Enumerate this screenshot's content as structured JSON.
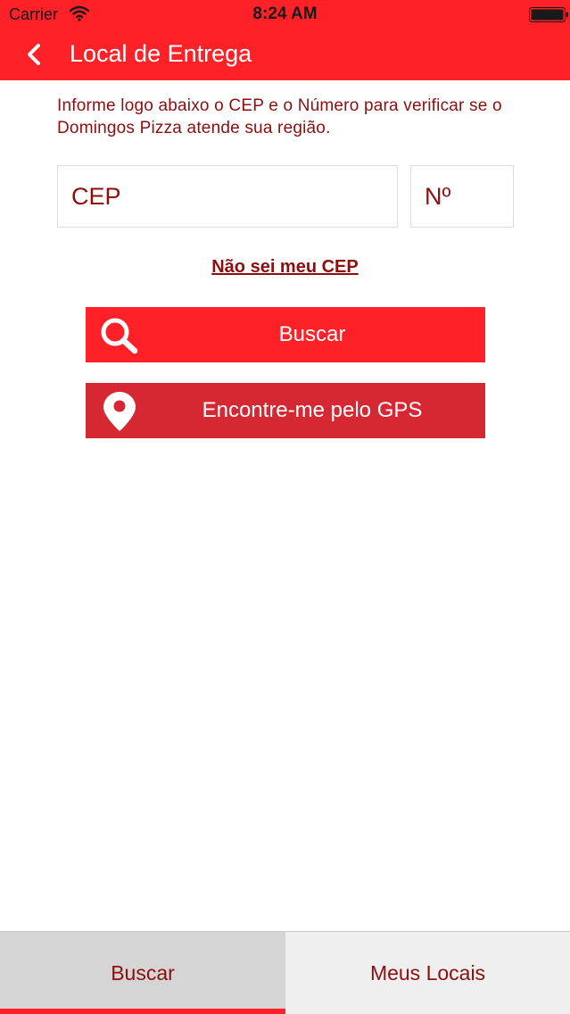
{
  "status_bar": {
    "carrier": "Carrier",
    "time": "8:24 AM",
    "icons": [
      "wifi-icon",
      "battery-icon"
    ]
  },
  "nav": {
    "title": "Local de Entrega",
    "back_icon": "chevron-left-icon"
  },
  "intro_text": "Informe logo abaixo o CEP e o Número para verificar se o Domingos Pizza atende sua região.",
  "form": {
    "cep_placeholder": "CEP",
    "number_placeholder": "Nº",
    "cep_value": "",
    "number_value": ""
  },
  "links": {
    "unknown_cep": "Não sei meu CEP"
  },
  "buttons": {
    "search_label": "Buscar",
    "search_icon": "search-icon",
    "gps_label": "Encontre-me pelo GPS",
    "gps_icon": "map-pin-icon"
  },
  "tabs": [
    {
      "label": "Buscar",
      "selected": true
    },
    {
      "label": "Meus Locais",
      "selected": false
    }
  ],
  "colors": {
    "brand_red": "#ff2128",
    "gps_red": "#d52832",
    "text_dark_red": "#8c0f10"
  }
}
